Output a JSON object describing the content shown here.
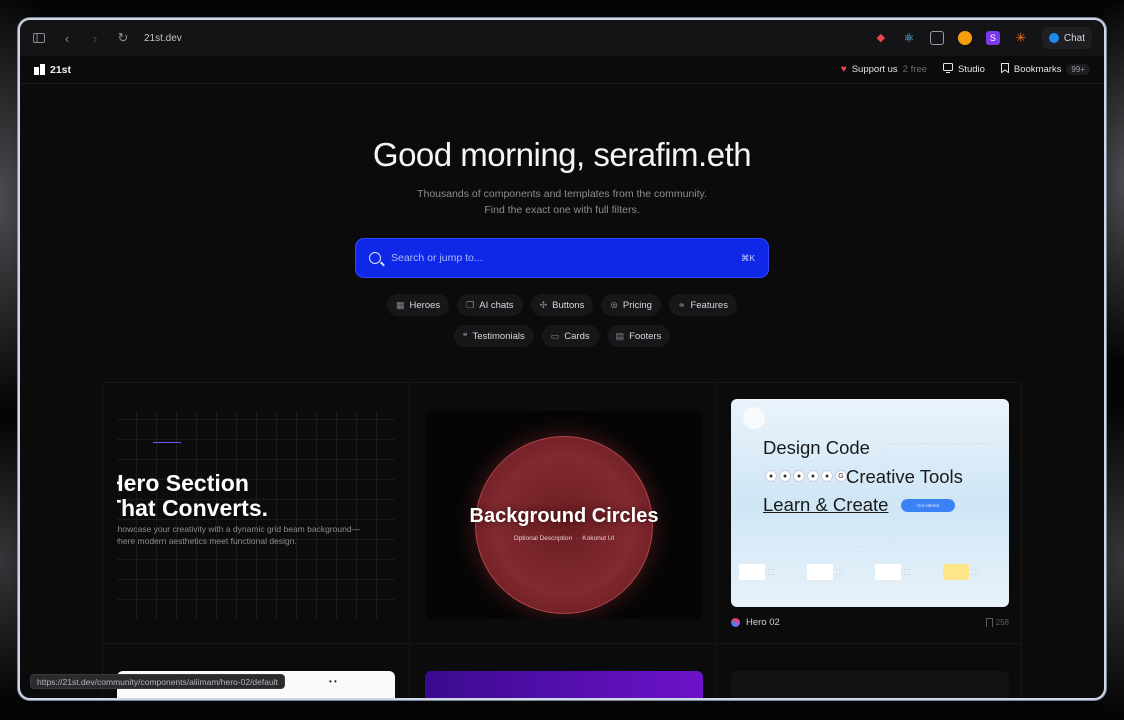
{
  "browser": {
    "url": "21st.dev",
    "chat_label": "Chat",
    "extension_icons": [
      "red-diamond-icon",
      "react-atom-icon",
      "game-controller-icon",
      "orange-circle-icon",
      "s-purple-icon",
      "asterisk-icon"
    ]
  },
  "site": {
    "brand": "21st",
    "support_label": "Support us",
    "support_note": "2 free",
    "studio_label": "Studio",
    "bookmarks_label": "Bookmarks",
    "bookmarks_badge": "99+"
  },
  "hero": {
    "title": "Good morning, serafim.eth",
    "subtitle_line1": "Thousands of components and templates from the community.",
    "subtitle_line2": "Find the exact one with full filters.",
    "search_placeholder": "Search or jump to...",
    "search_shortcut": "⌘K"
  },
  "chips_row1": [
    {
      "label": "Heroes",
      "icon": "grid-icon"
    },
    {
      "label": "AI chats",
      "icon": "chat-bubbles-icon"
    },
    {
      "label": "Buttons",
      "icon": "pointer-click-icon"
    },
    {
      "label": "Pricing",
      "icon": "dollar-circle-icon"
    },
    {
      "label": "Features",
      "icon": "link-icon"
    }
  ],
  "chips_row2": [
    {
      "label": "Testimonials",
      "icon": "quote-icon"
    },
    {
      "label": "Cards",
      "icon": "card-icon"
    },
    {
      "label": "Footers",
      "icon": "footer-layout-icon"
    }
  ],
  "cards": {
    "card1": {
      "title_line1": "Hero Section",
      "title_line2": "That Converts.",
      "subtitle_line1": "Showcase your creativity with a dynamic grid beam background—",
      "subtitle_line2": "where modern aesthetics meet functional design."
    },
    "card2": {
      "title": "Background Circles",
      "meta1": "Optional Description",
      "meta2": "Kokonut UI"
    },
    "card3": {
      "line1": "Design Code",
      "line2": "Creative Tools",
      "line3": "Learn & Create",
      "button": "Get started",
      "name": "Hero 02",
      "bookmarks": "258"
    }
  },
  "status_url": "https://21st.dev/community/components/aliimam/hero-02/default",
  "colors": {
    "search_bg": "#0f27e6",
    "accent_heart": "#e5484d",
    "chat_dot": "#1d8bf1"
  }
}
